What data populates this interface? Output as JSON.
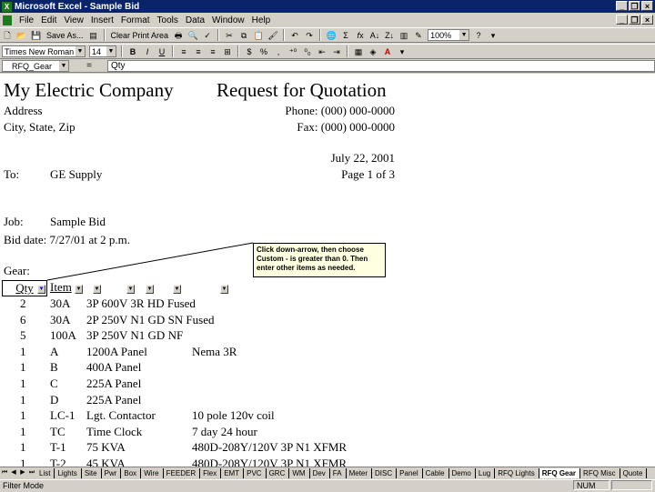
{
  "window": {
    "title": "Microsoft Excel - Sample Bid"
  },
  "menu": {
    "items": [
      "File",
      "Edit",
      "View",
      "Insert",
      "Format",
      "Tools",
      "Data",
      "Window",
      "Help"
    ]
  },
  "toolbar": {
    "save_as": "Save As...",
    "clear_print_area": "Clear Print Area",
    "zoom": "100%"
  },
  "format": {
    "font_name": "Times New Roman",
    "font_size": "14"
  },
  "formula_bar": {
    "name_box": "RFQ_Gear",
    "equals": "=",
    "content": "Qty"
  },
  "sheet": {
    "company": "My Electric Company",
    "doc_title": "Request for Quotation",
    "address": "Address",
    "city": "City, State, Zip",
    "phone": "Phone: (000) 000-0000",
    "fax": "Fax: (000) 000-0000",
    "date": "July 22, 2001",
    "page": "Page 1 of  3",
    "to_label": "To:",
    "to_value": "GE Supply",
    "job_label": "Job:",
    "job_value": "Sample Bid",
    "bid_date": "Bid date: 7/27/01 at 2 p.m.",
    "gear_label": "Gear:",
    "col_qty": "Qty",
    "col_item": "Item",
    "comment": "Click down-arrow, then choose Custom - is greater than 0. Then enter other items as needed.",
    "rows": [
      {
        "qty": "2",
        "item": "30A",
        "desc": "3P  600V  3R  HD Fused",
        "note": ""
      },
      {
        "qty": "6",
        "item": "30A",
        "desc": "2P  250V  N1  GD SN Fused",
        "note": ""
      },
      {
        "qty": "5",
        "item": "100A",
        "desc": "3P  250V  N1  GD NF",
        "note": ""
      },
      {
        "qty": "1",
        "item": "A",
        "desc": "1200A Panel",
        "note": "Nema 3R"
      },
      {
        "qty": "1",
        "item": "B",
        "desc": "400A Panel",
        "note": ""
      },
      {
        "qty": "1",
        "item": "C",
        "desc": "225A Panel",
        "note": ""
      },
      {
        "qty": "1",
        "item": "D",
        "desc": "225A Panel",
        "note": ""
      },
      {
        "qty": "1",
        "item": "LC-1",
        "desc": "Lgt. Contactor",
        "note": "10 pole 120v coil"
      },
      {
        "qty": "1",
        "item": "TC",
        "desc": "Time Clock",
        "note": "7 day 24 hour"
      },
      {
        "qty": "1",
        "item": "T-1",
        "desc": "75 KVA",
        "note": "480D-208Y/120V 3P N1 XFMR"
      },
      {
        "qty": "1",
        "item": "T-2",
        "desc": "45 KVA",
        "note": "480D-208Y/120V 3P N1 XFMR"
      }
    ]
  },
  "tabs": [
    "List",
    "Lights",
    "Site",
    "Pwr",
    "Box",
    "Wire",
    "FEEDER",
    "Flex",
    "EMT",
    "PVC",
    "GRC",
    "WM",
    "Dev",
    "FA",
    "Meter",
    "DISC",
    "Panel",
    "Cable",
    "Demo",
    "Lug",
    "RFQ Lights",
    "RFQ Gear",
    "RFQ Misc",
    "Quote"
  ],
  "active_tab": "RFQ Gear",
  "status": {
    "mode": "Filter Mode",
    "num": "NUM"
  },
  "colors": {
    "title_bar": "#0a246a",
    "chrome": "#d4d0c8",
    "comment_bg": "#ffffe1",
    "filter_active": "#0000ff"
  }
}
